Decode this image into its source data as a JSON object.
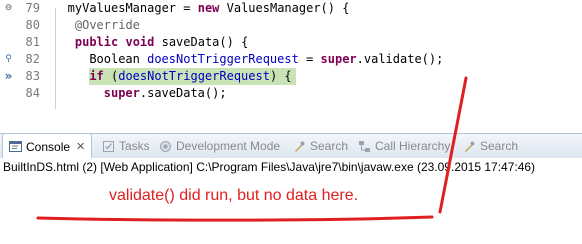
{
  "editor": {
    "lines": [
      {
        "num": "79",
        "marker": "fold",
        "indent": "   ",
        "segments": [
          [
            "",
            "myValuesManager"
          ],
          [
            "",
            " = "
          ],
          [
            "kw",
            "new"
          ],
          [
            "",
            " ValuesManager() {"
          ]
        ]
      },
      {
        "num": "80",
        "marker": "",
        "indent": "    ",
        "segments": [
          [
            "ann",
            "@Override"
          ]
        ]
      },
      {
        "num": "81",
        "marker": "",
        "indent": "    ",
        "segments": [
          [
            "kw",
            "public"
          ],
          [
            "",
            " "
          ],
          [
            "kw",
            "void"
          ],
          [
            "",
            " saveData() {"
          ]
        ]
      },
      {
        "num": "82",
        "marker": "search",
        "indent": "      ",
        "segments": [
          [
            "",
            "Boolean "
          ],
          [
            "fld",
            "doesNotTriggerRequest"
          ],
          [
            "",
            " = "
          ],
          [
            "kw",
            "super"
          ],
          [
            "",
            ".validate();"
          ]
        ]
      },
      {
        "num": "83",
        "marker": "arrow",
        "indent": "      ",
        "highlight": true,
        "segments": [
          [
            "kw",
            "if"
          ],
          [
            "",
            " ("
          ],
          [
            "fld",
            "doesNotTriggerRequest"
          ],
          [
            "",
            ") {"
          ]
        ]
      },
      {
        "num": "84",
        "marker": "",
        "indent": "        ",
        "segments": [
          [
            "kw",
            "super"
          ],
          [
            "",
            ".saveData();"
          ]
        ]
      }
    ]
  },
  "tabs": [
    {
      "label": "Console",
      "icon": "console-icon",
      "active": true
    },
    {
      "label": "Tasks",
      "icon": "tasks-icon"
    },
    {
      "label": "Development Mode",
      "icon": "development-mode-icon"
    },
    {
      "label": "Search",
      "icon": "search-icon"
    },
    {
      "label": "Call Hierarchy",
      "icon": "call-hierarchy-icon"
    },
    {
      "label": "Search",
      "icon": "search-icon"
    }
  ],
  "console": {
    "header": "BuiltInDS.html (2) [Web Application] C:\\Program Files\\Java\\jre7\\bin\\javaw.exe (23.09.2015 17:47:46)"
  },
  "annotation": {
    "text": "validate() did run, but no data here.",
    "color": "#e02020"
  },
  "colors": {
    "keyword": "#7f0055",
    "field": "#0000c0",
    "annotation": "#646464",
    "highlight": "#c9e2b6"
  }
}
